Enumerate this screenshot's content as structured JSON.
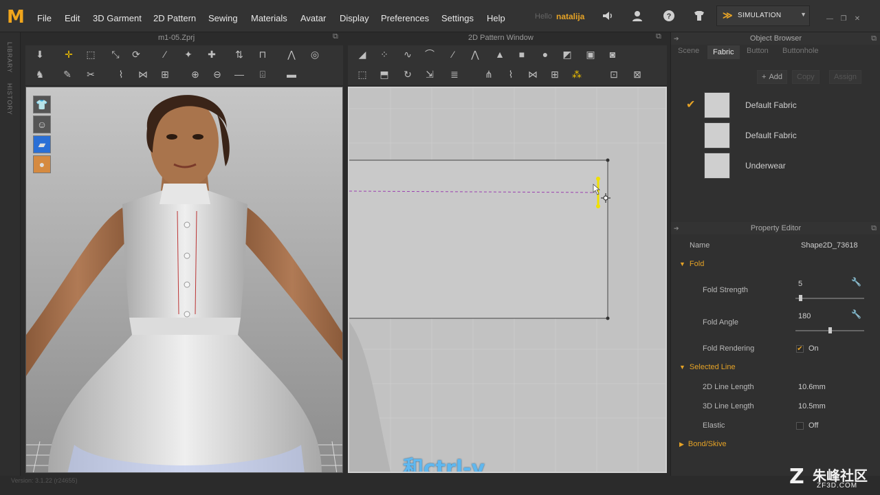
{
  "app": {
    "logo": "M",
    "menu": [
      "File",
      "Edit",
      "3D Garment",
      "2D Pattern",
      "Sewing",
      "Materials",
      "Avatar",
      "Display",
      "Preferences",
      "Settings",
      "Help"
    ],
    "hello": "Hello",
    "username": "natalija",
    "simulation_label": "SIMULATION",
    "accent": "#e6a326"
  },
  "left_tabs": [
    "LIBRARY",
    "HISTORY"
  ],
  "viewport3d": {
    "title": "m1-05.Zprj",
    "side_icons": [
      "garment-icon",
      "avatar-icon",
      "fabric-icon",
      "avatar-skin-icon"
    ]
  },
  "viewport2d": {
    "title": "2D Pattern Window",
    "subtitle": "和ctrl-v"
  },
  "object_browser": {
    "title": "Object Browser",
    "tabs": [
      "Scene",
      "Fabric",
      "Button",
      "Buttonhole"
    ],
    "active_tab": "Fabric",
    "buttons": {
      "add": "Add",
      "copy": "Copy",
      "assign": "Assign"
    },
    "fabrics": [
      {
        "name": "Default Fabric",
        "selected": true
      },
      {
        "name": "Default Fabric",
        "selected": false
      },
      {
        "name": "Underwear",
        "selected": false
      }
    ]
  },
  "property_editor": {
    "title": "Property Editor",
    "name_label": "Name",
    "name_value": "Shape2D_73618",
    "fold_section": "Fold",
    "fold_strength_label": "Fold Strength",
    "fold_strength_value": "5",
    "fold_strength_level": 0.05,
    "fold_angle_label": "Fold Angle",
    "fold_angle_value": "180",
    "fold_angle_level": 0.5,
    "fold_rendering_label": "Fold Rendering",
    "fold_rendering_value": "On",
    "selected_line_section": "Selected Line",
    "line2d_label": "2D Line Length",
    "line2d_value": "10.6mm",
    "line3d_label": "3D Line Length",
    "line3d_value": "10.5mm",
    "elastic_label": "Elastic",
    "elastic_value": "Off",
    "bond_section": "Bond/Skive"
  },
  "status": {
    "version": "Version: 3.1.22    (r24655)"
  },
  "watermark": {
    "main": "朱峰社区",
    "sub": "ZF3D.COM"
  }
}
